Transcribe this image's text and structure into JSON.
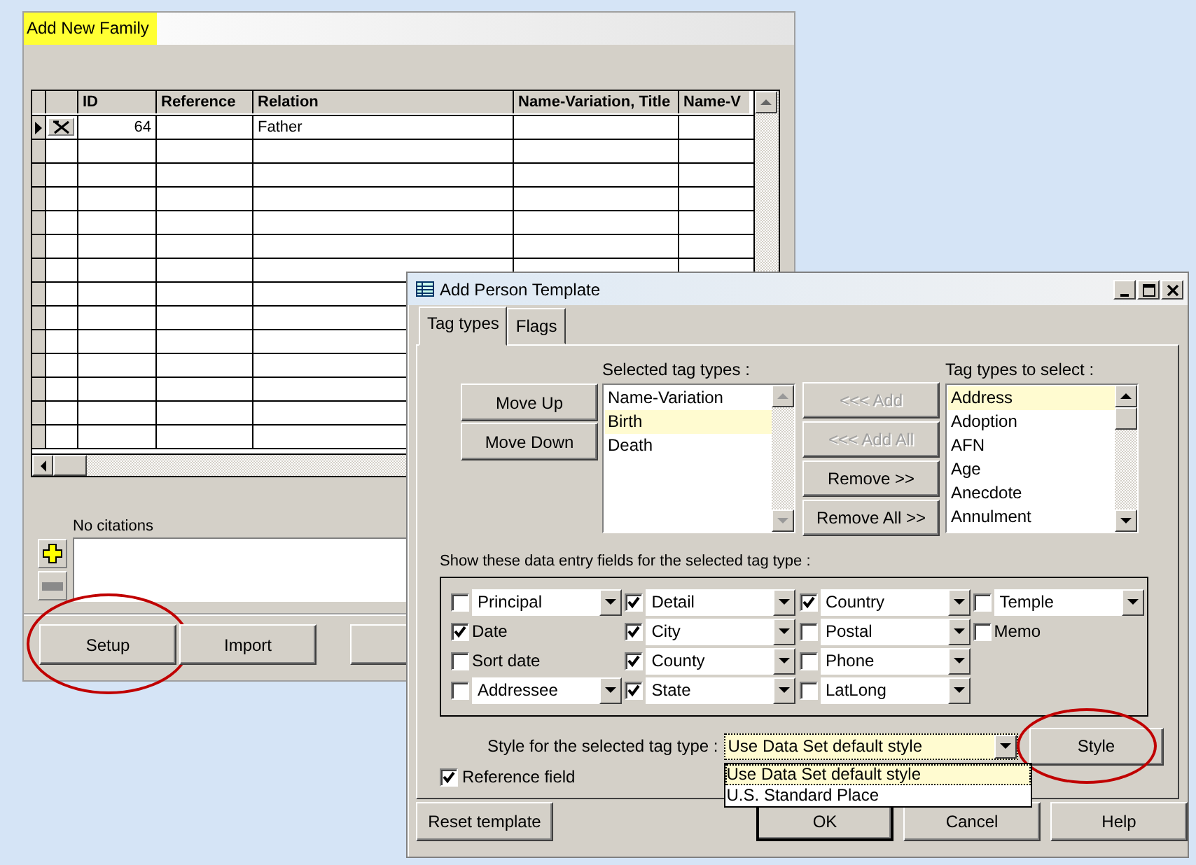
{
  "family_window": {
    "title": "Add New Family",
    "grid": {
      "columns": [
        "ID",
        "Reference",
        "Relation",
        "Name-Variation, Title",
        "Name-V"
      ],
      "rows": [
        {
          "current": true,
          "id": "64",
          "relation": "Father"
        }
      ]
    },
    "citations": {
      "label": "No citations"
    },
    "buttons": [
      {
        "label": "Setup",
        "circled": true
      },
      {
        "label": "Import",
        "circled": false
      }
    ]
  },
  "template_window": {
    "title": "Add Person Template",
    "tabs": [
      {
        "label": "Tag types",
        "selected": true
      },
      {
        "label": "Flags",
        "selected": false
      }
    ],
    "order_buttons": [
      "Move Up",
      "Move Down"
    ],
    "selected_label": "Selected tag types :",
    "selected_list": [
      {
        "label": "Name-Variation",
        "selected": false
      },
      {
        "label": "Birth",
        "selected": true
      },
      {
        "label": "Death",
        "selected": false
      }
    ],
    "transfer_buttons": [
      {
        "label": "<<< Add",
        "disabled": true
      },
      {
        "label": "<<< Add All",
        "disabled": true
      },
      {
        "label": "Remove >>",
        "disabled": false
      },
      {
        "label": "Remove All >>",
        "disabled": false
      }
    ],
    "available_label": "Tag types to select :",
    "available_list": [
      {
        "label": "Address",
        "selected": true
      },
      {
        "label": "Adoption",
        "selected": false
      },
      {
        "label": "AFN",
        "selected": false
      },
      {
        "label": "Age",
        "selected": false
      },
      {
        "label": "Anecdote",
        "selected": false
      },
      {
        "label": "Annulment",
        "selected": false
      }
    ],
    "fields_label": "Show these data entry fields for the selected tag type :",
    "field_columns": [
      [
        {
          "label": "Principal",
          "kind": "combo",
          "checked": false
        },
        {
          "label": "Date",
          "kind": "plain",
          "checked": true
        },
        {
          "label": "Sort date",
          "kind": "plain",
          "checked": false
        },
        {
          "label": "Addressee",
          "kind": "combo",
          "checked": false
        }
      ],
      [
        {
          "label": "Detail",
          "kind": "combo",
          "checked": true
        },
        {
          "label": "City",
          "kind": "combo",
          "checked": true
        },
        {
          "label": "County",
          "kind": "combo",
          "checked": true
        },
        {
          "label": "State",
          "kind": "combo",
          "checked": true
        }
      ],
      [
        {
          "label": "Country",
          "kind": "combo",
          "checked": true
        },
        {
          "label": "Postal",
          "kind": "combo",
          "checked": false
        },
        {
          "label": "Phone",
          "kind": "combo",
          "checked": false
        },
        {
          "label": "LatLong",
          "kind": "combo",
          "checked": false
        }
      ],
      [
        {
          "label": "Temple",
          "kind": "combo",
          "checked": false
        },
        {
          "label": "Memo",
          "kind": "plain",
          "checked": false
        }
      ]
    ],
    "style": {
      "label": "Style for the selected tag type :",
      "value": "Use Data Set default style",
      "options": [
        {
          "label": "Use Data Set default style",
          "selected": true
        },
        {
          "label": "U.S. Standard Place",
          "selected": false
        }
      ],
      "button": {
        "label": "Style",
        "circled": true
      }
    },
    "reference_field": {
      "label": "Reference field",
      "checked": true
    },
    "footer_buttons": [
      {
        "label": "Reset template",
        "default": false
      },
      {
        "label": "OK",
        "default": true
      },
      {
        "label": "Cancel",
        "default": false
      },
      {
        "label": "Help",
        "default": false
      }
    ]
  }
}
